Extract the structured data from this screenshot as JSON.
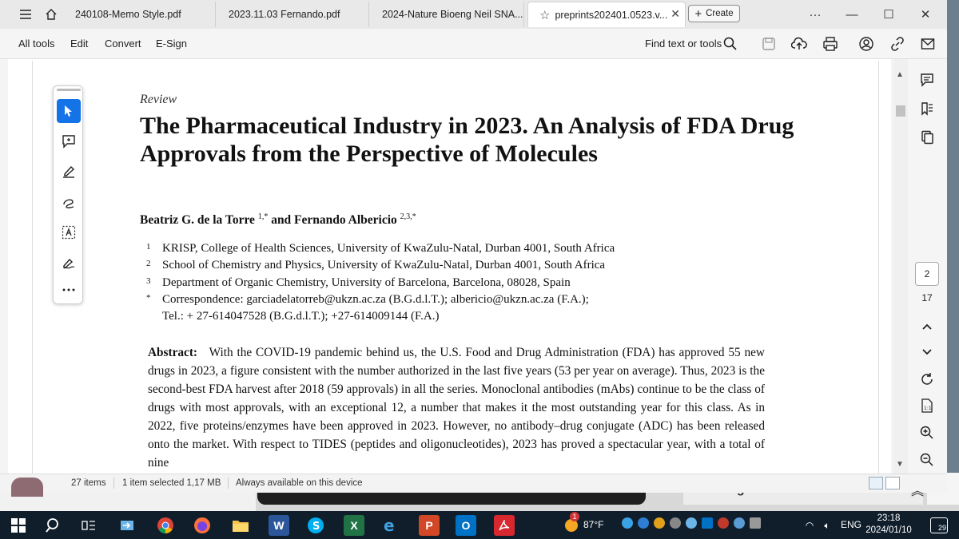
{
  "tabs": [
    {
      "label": "240108-Memo Style.pdf"
    },
    {
      "label": "2023.11.03 Fernando.pdf"
    },
    {
      "label": "2024-Nature Bioeng Neil SNA..."
    },
    {
      "label": "preprints202401.0523.v..."
    }
  ],
  "create_label": "Create",
  "toolbar": {
    "menu": [
      "All tools",
      "Edit",
      "Convert",
      "E-Sign"
    ],
    "find_label": "Find text or tools"
  },
  "paper": {
    "section": "Review",
    "title": "The Pharmaceutical Industry in 2023. An Analysis of FDA Drug Approvals from the Perspective of Molecules",
    "authors_a": "Beatriz G. de la Torre ",
    "authors_a_sup": "1,*",
    "authors_and": " and Fernando Albericio ",
    "authors_b_sup": "2,3,*",
    "affiliations": [
      {
        "n": "1",
        "text": "KRISP, College of Health Sciences, University of KwaZulu-Natal, Durban 4001, South Africa"
      },
      {
        "n": "2",
        "text": "School of Chemistry and Physics, University of KwaZulu-Natal, Durban 4001, South Africa"
      },
      {
        "n": "3",
        "text": "Department of Organic Chemistry, University of Barcelona, Barcelona, 08028, Spain"
      },
      {
        "n": "*",
        "text": "Correspondence: garciadelatorreb@ukzn.ac.za (B.G.d.l.T.); albericio@ukzn.ac.za (F.A.);"
      },
      {
        "n": "",
        "text": "Tel.: + 27-614047528 (B.G.d.l.T.); +27-614009144 (F.A.)"
      }
    ],
    "abstract_label": "Abstract:",
    "abstract_text": "With the COVID-19 pandemic behind us, the U.S. Food and Drug Administration (FDA) has approved 55 new drugs in 2023, a figure consistent with the number authorized in the last five years (53 per year on average). Thus, 2023 is the second-best FDA harvest after 2018 (59 approvals) in all the series. Monoclonal antibodies (mAbs) continue to be the class of drugs with most approvals, with an exceptional 12, a number that makes it the most outstanding year for this class.   As in 2022, five proteins/enzymes have been approved in 2023.   However, no antibody–drug conjugate (ADC) has been released onto the market. With respect to TIDES (peptides and oligonucleotides), 2023 has proved a spectacular year, with a total of nine"
  },
  "page_nav": {
    "current": "2",
    "total": "17"
  },
  "status": {
    "items": "27 items",
    "selected": "1 item selected  1,17 MB",
    "availability": "Always available on this device"
  },
  "desktop": {
    "messages_label": "Messages"
  },
  "taskbar": {
    "weather": "87°F",
    "weather_badge": "1",
    "language": "ENG",
    "time": "23:18",
    "date": "2024/01/10",
    "notifications": "29"
  }
}
